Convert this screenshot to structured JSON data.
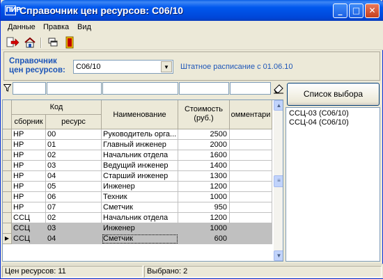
{
  "window": {
    "title": "Справочник цен ресурсов: С06/10",
    "app_icon_text": "ПИР",
    "controls": {
      "minimize": "_",
      "maximize": "□",
      "close": "✕"
    }
  },
  "menu": [
    "Данные",
    "Правка",
    "Вид"
  ],
  "toolbar": {
    "icons": [
      "export-red-arrow-icon",
      "house-save-icon",
      "window-tile-icon",
      "exit-door-icon"
    ]
  },
  "filter": {
    "label": "Справочник\nцен ресурсов:",
    "combo_value": "С06/10",
    "schedule_note": "Штатное расписание с 01.06.10"
  },
  "grid": {
    "headers": {
      "code_group": "Код",
      "collection": "сборник",
      "resource": "ресурс",
      "name": "Наименование",
      "cost": "Стоимость\n(руб.)",
      "comments": "омментари"
    },
    "rows": [
      {
        "collection": "НР",
        "resource": "00",
        "name": "Руководитель орга...",
        "cost": "2500",
        "comment": ""
      },
      {
        "collection": "НР",
        "resource": "01",
        "name": "Главный инженер",
        "cost": "2000",
        "comment": ""
      },
      {
        "collection": "НР",
        "resource": "02",
        "name": "Начальник отдела",
        "cost": "1600",
        "comment": ""
      },
      {
        "collection": "НР",
        "resource": "03",
        "name": "Ведущий инженер",
        "cost": "1400",
        "comment": ""
      },
      {
        "collection": "НР",
        "resource": "04",
        "name": "Старший инженер",
        "cost": "1300",
        "comment": ""
      },
      {
        "collection": "НР",
        "resource": "05",
        "name": "Инженер",
        "cost": "1200",
        "comment": ""
      },
      {
        "collection": "НР",
        "resource": "06",
        "name": "Техник",
        "cost": "1000",
        "comment": ""
      },
      {
        "collection": "НР",
        "resource": "07",
        "name": "Сметчик",
        "cost": "950",
        "comment": ""
      },
      {
        "collection": "ССЦ",
        "resource": "02",
        "name": "Начальник отдела",
        "cost": "1200",
        "comment": ""
      },
      {
        "collection": "ССЦ",
        "resource": "03",
        "name": "Инженер",
        "cost": "1000",
        "comment": ""
      },
      {
        "collection": "ССЦ",
        "resource": "04",
        "name": "Сметчик",
        "cost": "600",
        "comment": ""
      }
    ],
    "selected_rows": [
      9,
      10
    ],
    "current_row": 10,
    "current_row_marker": "▶"
  },
  "pick_panel": {
    "button_label": "Список выбора",
    "items": [
      "ССЦ-03 (С06/10)",
      "ССЦ-04 (С06/10)"
    ]
  },
  "status": {
    "resource_count": "Цен ресурсов: 11",
    "selected": "Выбрано: 2"
  },
  "colors": {
    "title_bar": "#0058ee",
    "accent_label": "#1e56b8",
    "selected_row": "#c0c0c0",
    "window_bg": "#ece9d8"
  }
}
